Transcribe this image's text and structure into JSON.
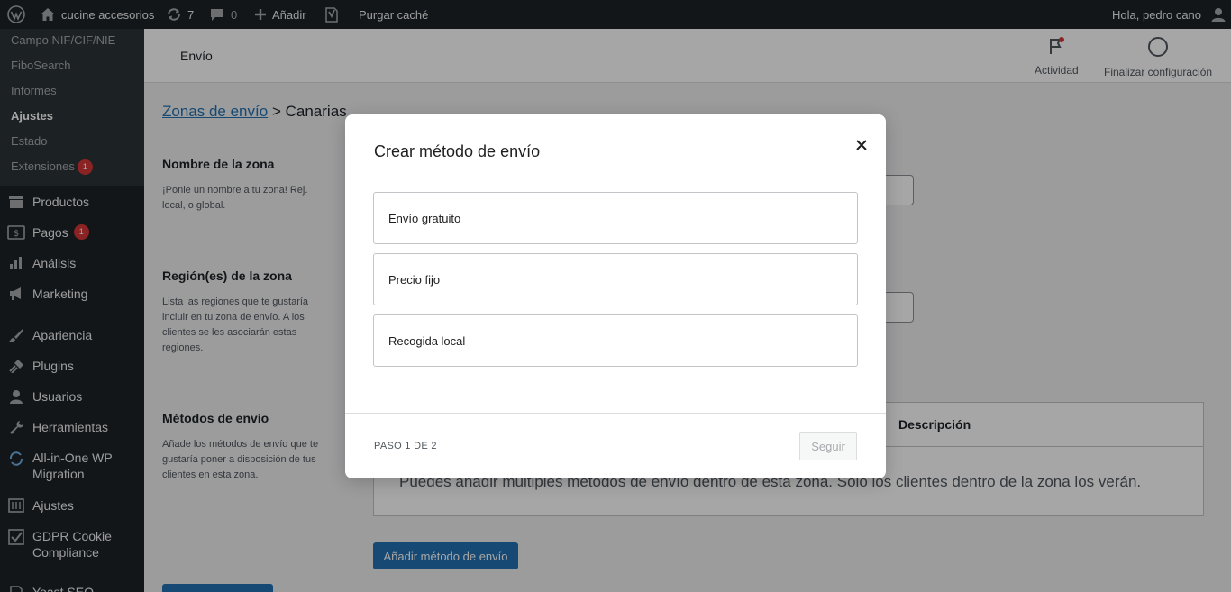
{
  "adminbar": {
    "site_name": "cucine accesorios",
    "updates_count": "7",
    "comments_count": "0",
    "add_new": "Añadir",
    "purge_cache": "Purgar caché",
    "greeting": "Hola, pedro cano"
  },
  "sidebar": {
    "submenu": [
      {
        "label": "Campo NIF/CIF/NIE"
      },
      {
        "label": "FiboSearch"
      },
      {
        "label": "Informes"
      },
      {
        "label": "Ajustes"
      },
      {
        "label": "Estado"
      },
      {
        "label": "Extensiones",
        "badge": "1"
      }
    ],
    "menu": [
      {
        "label": "Productos"
      },
      {
        "label": "Pagos",
        "badge": "1"
      },
      {
        "label": "Análisis"
      },
      {
        "label": "Marketing"
      },
      {
        "label": "Apariencia"
      },
      {
        "label": "Plugins"
      },
      {
        "label": "Usuarios"
      },
      {
        "label": "Herramientas"
      },
      {
        "label": "All-in-One WP Migration"
      },
      {
        "label": "Ajustes"
      },
      {
        "label": "GDPR Cookie Compliance"
      },
      {
        "label": "Yoast SEO"
      }
    ]
  },
  "header": {
    "title": "Envío",
    "activity": "Actividad",
    "finish_setup": "Finalizar configuración"
  },
  "page": {
    "breadcrumb_link": "Zonas de envío",
    "breadcrumb_sep": ">",
    "breadcrumb_current": "Canarias",
    "zone_name_title": "Nombre de la zona",
    "zone_name_desc": "¡Ponle un nombre a tu zona! Rej. local, o global.",
    "zone_regions_title": "Región(es) de la zona",
    "zone_regions_desc": "Lista las regiones que te gustaría incluir en tu zona de envío. A los clientes se les asociarán estas regiones.",
    "methods_title": "Métodos de envío",
    "methods_desc": "Añade los métodos de envío que te gustaría poner a disposición de tus clientes en esta zona.",
    "table_description_header": "Descripción",
    "table_empty": "Puedes añadir múltiples métodos de envío dentro de esta zona. Solo los clientes dentro de la zona los verán.",
    "add_method_button": "Añadir método de envío"
  },
  "modal": {
    "title": "Crear método de envío",
    "options": [
      {
        "label": "Envío gratuito"
      },
      {
        "label": "Precio fijo"
      },
      {
        "label": "Recogida local"
      }
    ],
    "step": "PASO 1 DE 2",
    "next_button": "Seguir"
  },
  "colors": {
    "admin_dark": "#1d2327",
    "accent_blue": "#2271b1",
    "badge_red": "#d63638"
  }
}
